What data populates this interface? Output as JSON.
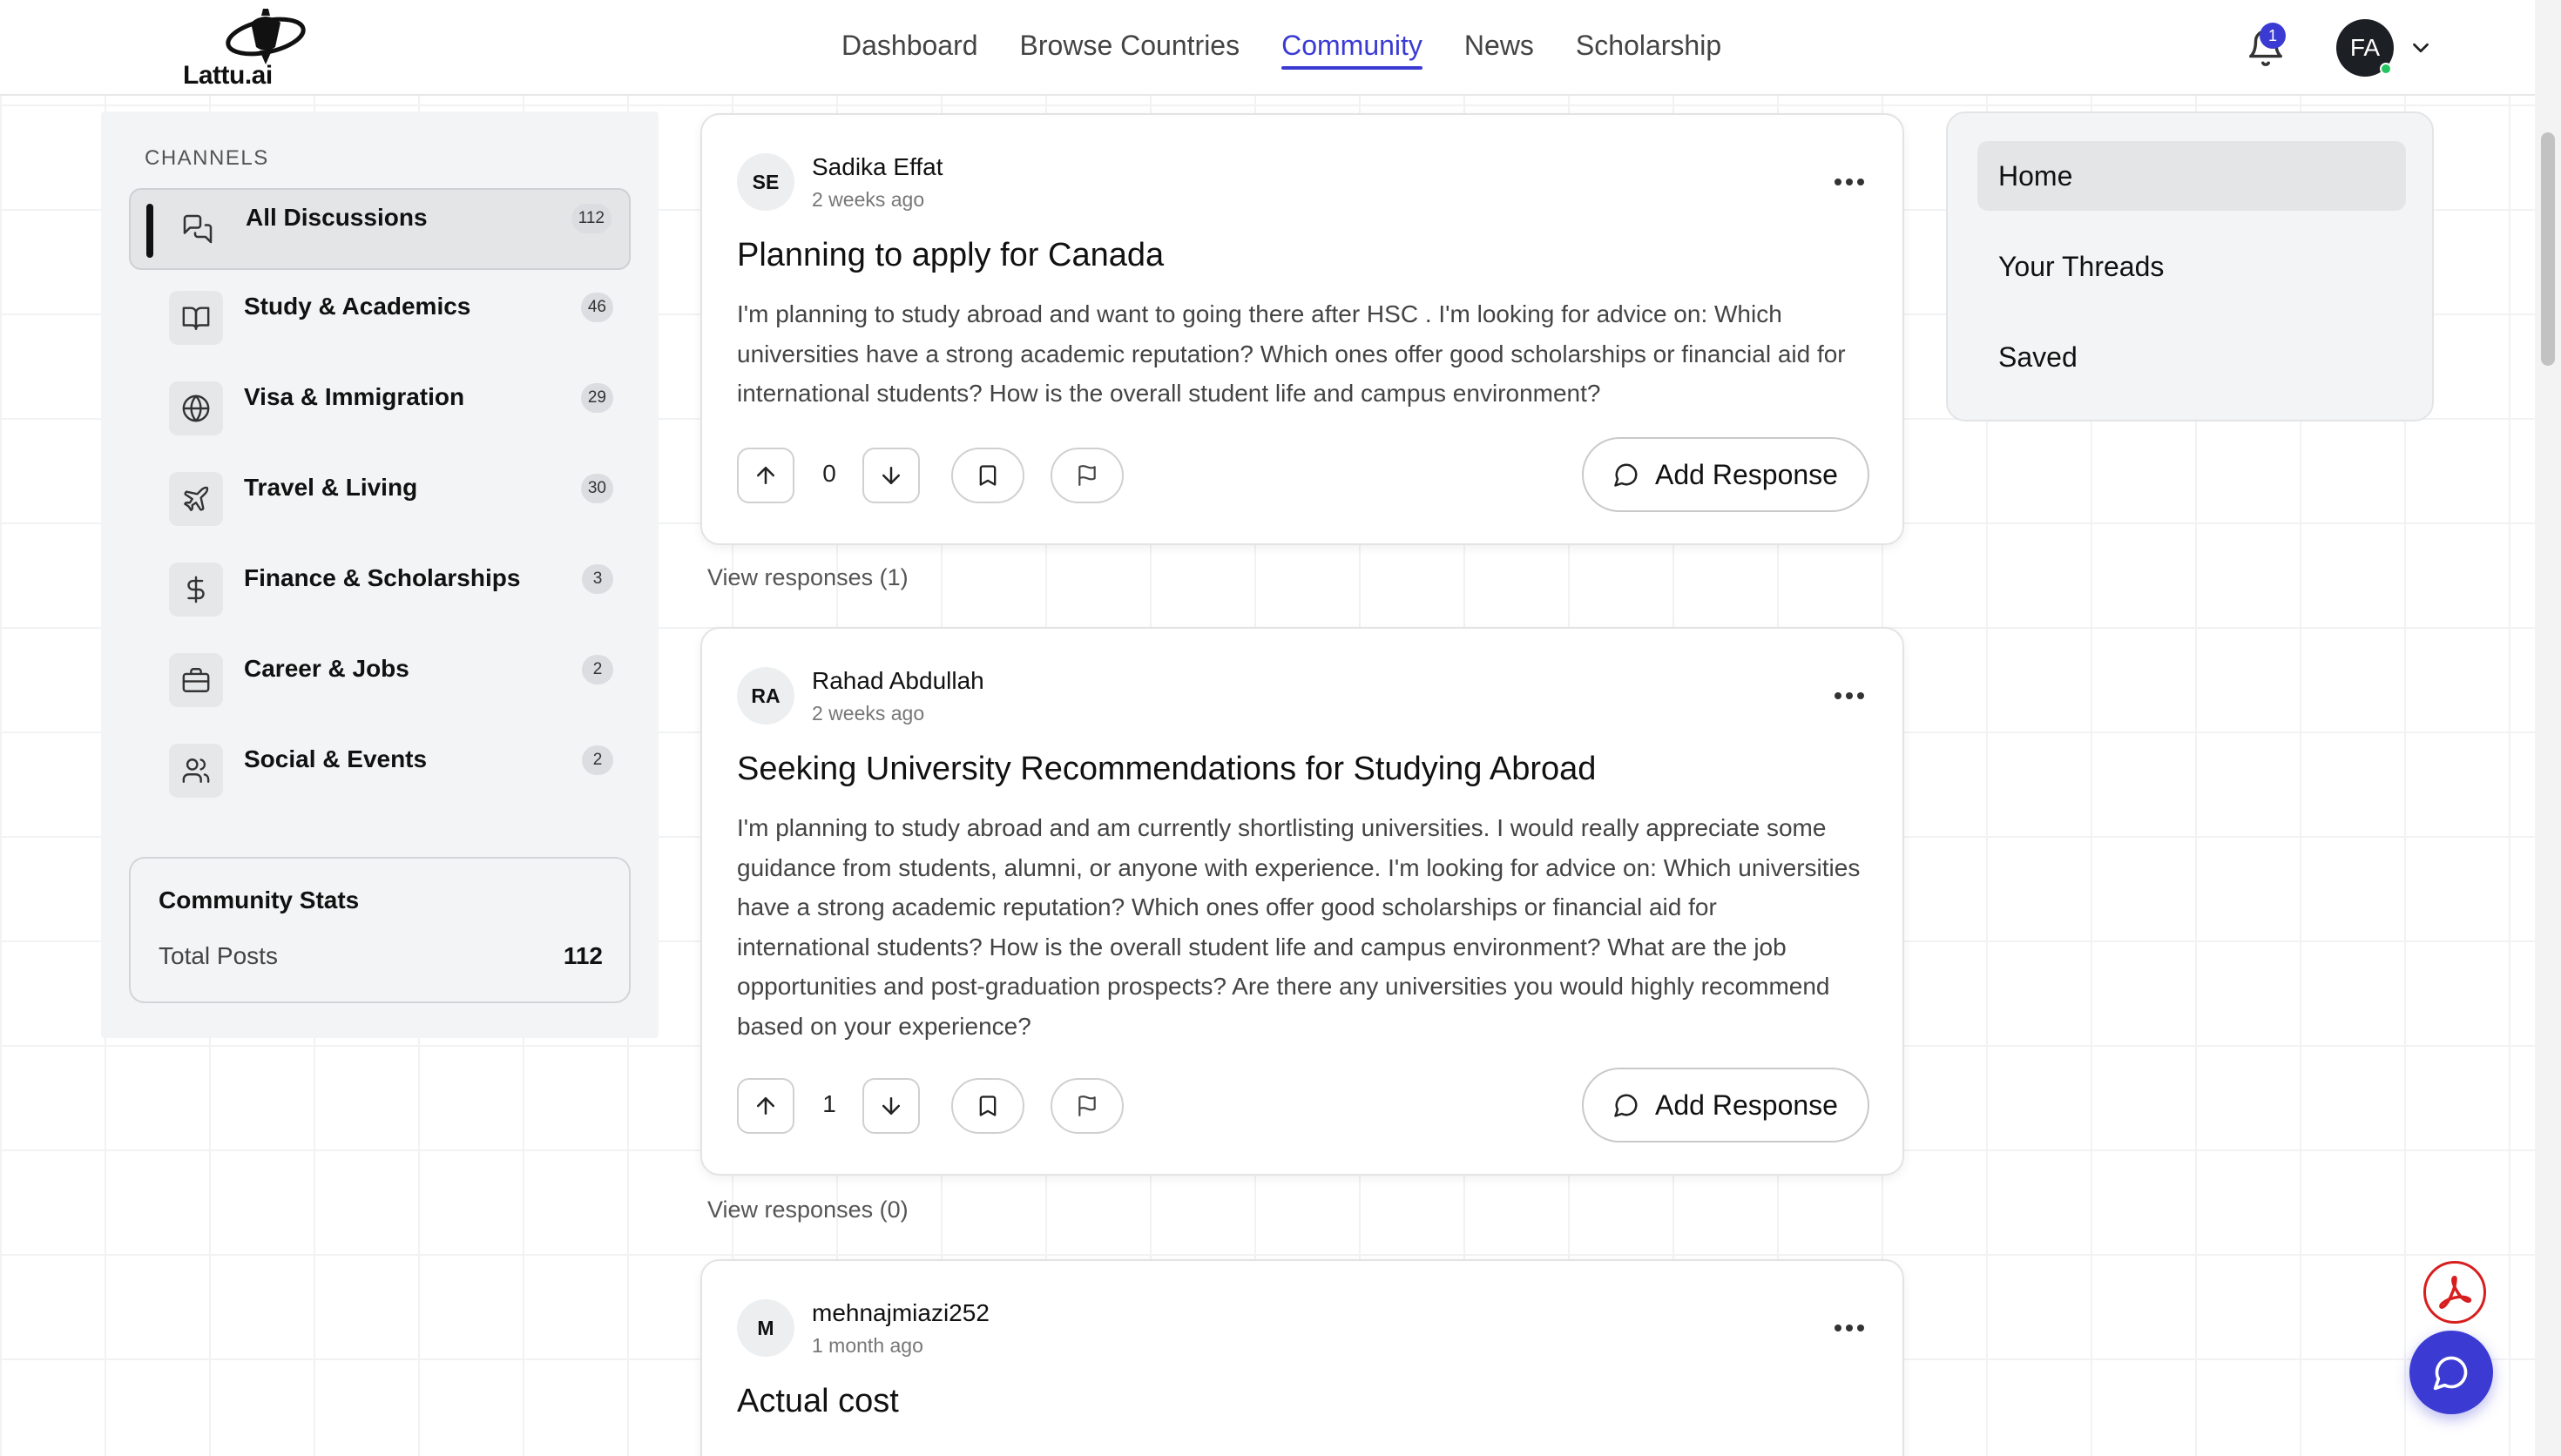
{
  "app": {
    "logo_text": "Lattu.ai",
    "accent": "#3b3bd4"
  },
  "nav": {
    "items": [
      {
        "label": "Dashboard",
        "active": false
      },
      {
        "label": "Browse Countries",
        "active": false
      },
      {
        "label": "Community",
        "active": true
      },
      {
        "label": "News",
        "active": false
      },
      {
        "label": "Scholarship",
        "active": false
      }
    ],
    "notification_count": "1",
    "user_initials": "FA"
  },
  "sidebar": {
    "channels_title": "CHANNELS",
    "channels": [
      {
        "label": "All Discussions",
        "count": "112",
        "icon": "chat-icon",
        "active": true
      },
      {
        "label": "Study & Academics",
        "count": "46",
        "icon": "book-icon",
        "active": false
      },
      {
        "label": "Visa & Immigration",
        "count": "29",
        "icon": "globe-icon",
        "active": false
      },
      {
        "label": "Travel & Living",
        "count": "30",
        "icon": "plane-icon",
        "active": false
      },
      {
        "label": "Finance & Scholarships",
        "count": "3",
        "icon": "dollar-icon",
        "active": false
      },
      {
        "label": "Career & Jobs",
        "count": "2",
        "icon": "briefcase-icon",
        "active": false
      },
      {
        "label": "Social & Events",
        "count": "2",
        "icon": "users-icon",
        "active": false
      }
    ],
    "stats": {
      "title": "Community Stats",
      "total_posts_label": "Total Posts",
      "total_posts_value": "112"
    }
  },
  "posts": [
    {
      "initials": "SE",
      "author": "Sadika Effat",
      "time": "2 weeks ago",
      "title": "Planning to apply for Canada",
      "body_lines": [
        "I'm planning to study abroad and want to going there after HSC . I'm looking for advice on: Which",
        "universities have a strong academic reputation? Which ones offer good scholarships or financial aid for",
        "international students? How is the overall student life and campus environment?"
      ],
      "votes": "0",
      "add_response_label": "Add Response",
      "view_responses_label": "View responses (1)"
    },
    {
      "initials": "RA",
      "author": "Rahad Abdullah",
      "time": "2 weeks ago",
      "title": "Seeking University Recommendations for Studying Abroad",
      "body_lines": [
        "I'm planning to study abroad and am currently shortlisting universities. I would really appreciate some",
        "guidance from students, alumni, or anyone with experience. I'm looking for advice on: Which universities",
        "have a strong academic reputation? Which ones offer good scholarships or financial aid for",
        "international students? How is the overall student life and campus environment? What are the job",
        "opportunities and post-graduation prospects? Are there any universities you would highly recommend",
        "based on your experience?"
      ],
      "votes": "1",
      "add_response_label": "Add Response",
      "view_responses_label": "View responses (0)"
    },
    {
      "initials": "M",
      "author": "mehnajmiazi252",
      "time": "1 month ago",
      "title": "Actual cost"
    }
  ],
  "right_panel": {
    "items": [
      {
        "label": "Home",
        "active": true
      },
      {
        "label": "Your Threads",
        "active": false
      },
      {
        "label": "Saved",
        "active": false
      }
    ]
  }
}
